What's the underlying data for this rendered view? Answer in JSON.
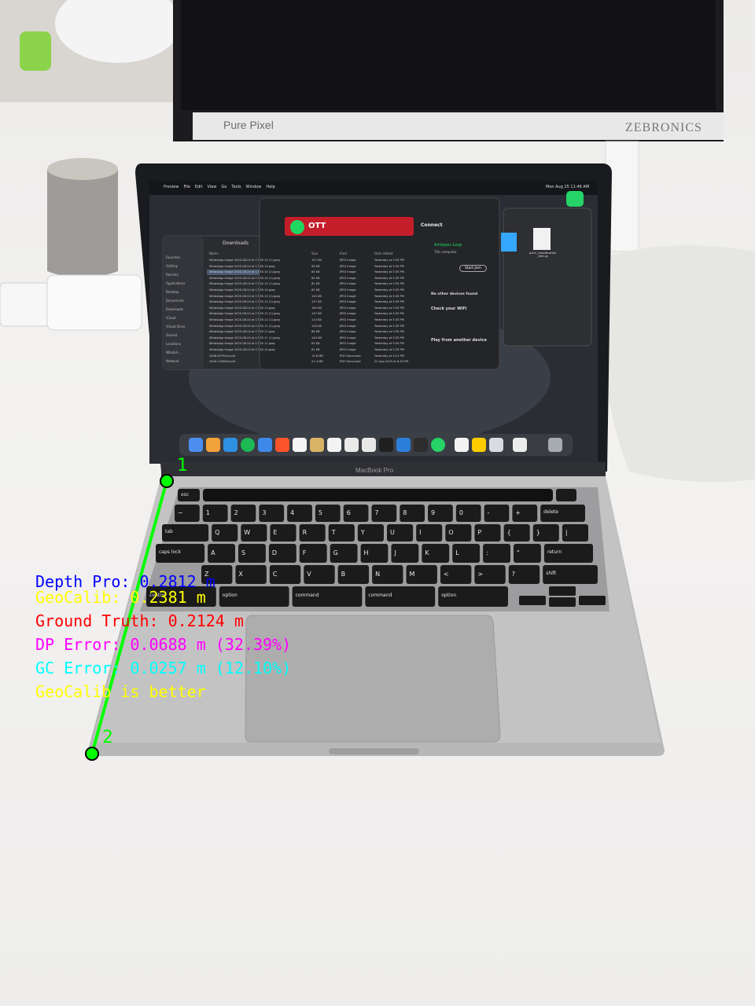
{
  "monitor": {
    "left_brand": "Pure Pixel",
    "right_brand": "ZEBRONICS"
  },
  "laptop": {
    "model_label": "MacBook Pro",
    "menubar": {
      "items": [
        "Preview",
        "File",
        "Edit",
        "View",
        "Go",
        "Tools",
        "Window",
        "Help"
      ],
      "clock": "Mon Aug 25 11:46 AM"
    },
    "finder": {
      "title": "Downloads",
      "sidebar_header": "Favorites",
      "sidebar_items": [
        "AirDrop",
        "Recents",
        "Applications",
        "Desktop",
        "Documents",
        "Downloads"
      ],
      "icloud_header": "iCloud",
      "icloud_items": [
        "iCloud Drive",
        "Shared"
      ],
      "locations_header": "Locations",
      "location_items": [
        "WhatsA...",
        "Network"
      ],
      "columns": [
        "Name",
        "Size",
        "Kind",
        "Date Added"
      ],
      "rows": [
        [
          "WhatsApp Image 2025-08-24 at 17.30.15 (1).jpeg",
          "107 KB",
          "JPEG image",
          "Yesterday at 5:35 PM"
        ],
        [
          "WhatsApp Image 2025-08-24 at 17.30.15.jpeg",
          "56 KB",
          "JPEG image",
          "Yesterday at 5:35 PM"
        ],
        [
          "WhatsApp Image 2025-08-24 at 17.30.14 (2).jpeg",
          "84 KB",
          "JPEG image",
          "Yesterday at 5:35 PM"
        ],
        [
          "WhatsApp Image 2025-08-24 at 17.30.14 (1).jpeg",
          "80 KB",
          "JPEG image",
          "Yesterday at 5:35 PM"
        ],
        [
          "WhatsApp Image 2025-08-24 at 17.30.13 (1).jpeg",
          "82 KB",
          "JPEG image",
          "Yesterday at 5:35 PM"
        ],
        [
          "WhatsApp Image 2025-08-24 at 17.30.14.jpeg",
          "82 KB",
          "JPEG image",
          "Yesterday at 5:35 PM"
        ],
        [
          "WhatsApp Image 2025-08-24 at 17.35.13 (2).jpeg",
          "120 KB",
          "JPEG image",
          "Yesterday at 5:35 PM"
        ],
        [
          "WhatsApp Image 2025-08-24 at 17.35.13 (1).jpeg",
          "137 KB",
          "JPEG image",
          "Yesterday at 5:35 PM"
        ],
        [
          "WhatsApp Image 2025-08-24 at 17.35.13.jpeg",
          "169 KB",
          "JPEG image",
          "Yesterday at 5:35 PM"
        ],
        [
          "WhatsApp Image 2025-08-24 at 17.35.12 (2).jpeg",
          "137 KB",
          "JPEG image",
          "Yesterday at 5:35 PM"
        ],
        [
          "WhatsApp Image 2025-08-24 at 17.35.12 (1).jpeg",
          "115 KB",
          "JPEG image",
          "Yesterday at 5:35 PM"
        ],
        [
          "WhatsApp Image 2025-08-24 at 17.35.11 (2).jpeg",
          "128 KB",
          "JPEG image",
          "Yesterday at 5:35 PM"
        ],
        [
          "WhatsApp Image 2025-08-24 at 17.35.11.jpeg",
          "66 KB",
          "JPEG image",
          "Yesterday at 5:35 PM"
        ],
        [
          "WhatsApp Image 2025-08-24 at 17.35.11 (1).jpeg",
          "140 KB",
          "JPEG image",
          "Yesterday at 5:35 PM"
        ],
        [
          "WhatsApp Image 2025-08-24 at 17.35.11.jpeg",
          "63 KB",
          "JPEG image",
          "Yesterday at 5:35 PM"
        ],
        [
          "WhatsApp Image 2025-08-24 at 17.35.10.jpeg",
          "61 KB",
          "JPEG image",
          "Yesterday at 5:35 PM"
        ],
        [
          "2408.09794v2.pdf",
          "13.8 MB",
          "PDF Document",
          "Yesterday at 4:21 PM"
        ],
        [
          "2404.15308v4.pdf",
          "21.4 MB",
          "PDF Document",
          "22 Aug 2025 at 6:43 PM"
        ]
      ]
    },
    "connect_panel": {
      "title": "Connect",
      "ott_label": "OTT",
      "device": "Airdopes Loop",
      "device_sub": "This computer",
      "start_jam": "Start Jam",
      "no_devices": "No other devices found",
      "check_wifi": "Check your WiFi",
      "play_other": "Play from another device"
    },
    "file_icon_label": "quick_classification_test.py"
  },
  "overlay": {
    "depth_pro": "Depth Pro: 0.2812 m",
    "geocalib": "GeoCalib: 0.2381 m",
    "ground_truth": "Ground Truth: 0.2124 m",
    "dp_error": "DP Error: 0.0688 m (32.39%)",
    "gc_error": "GC Error: 0.0257 m (12.10%)",
    "verdict": "GeoCalib is better",
    "colors": {
      "depth_pro": "#0000ff",
      "geocalib": "#ffff00",
      "ground_truth": "#ff0000",
      "dp_error": "#ff00ff",
      "gc_error": "#00ffff",
      "verdict": "#ffff00",
      "measure_line": "#00ff00"
    },
    "point_1": "1",
    "point_2": "2"
  },
  "keyboard": {
    "row1": [
      "esc"
    ],
    "row2": [
      "~",
      "1",
      "2",
      "3",
      "4",
      "5",
      "6",
      "7",
      "8",
      "9",
      "0",
      "-",
      "+",
      "delete"
    ],
    "row3": [
      "tab",
      "Q",
      "W",
      "E",
      "R",
      "T",
      "Y",
      "U",
      "I",
      "O",
      "P",
      "{",
      "}",
      "|"
    ],
    "row4": [
      "caps lock",
      "A",
      "S",
      "D",
      "F",
      "G",
      "H",
      "J",
      "K",
      "L",
      ":",
      "\"",
      "return"
    ],
    "row5": [
      "Z",
      "X",
      "C",
      "V",
      "B",
      "N",
      "M",
      "<",
      ">",
      "?",
      "shift"
    ],
    "row6": [
      "control",
      "option",
      "command",
      "command",
      "option"
    ]
  }
}
